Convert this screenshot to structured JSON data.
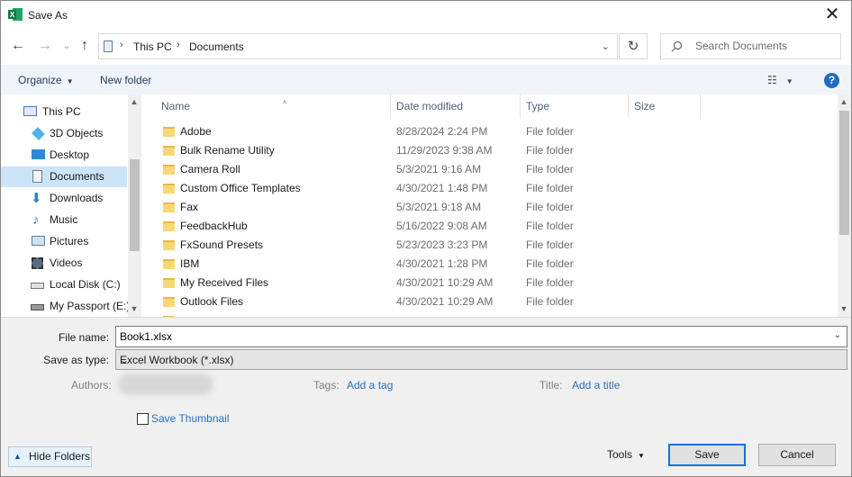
{
  "window": {
    "title": "Save As",
    "close_glyph": "✕"
  },
  "nav": {
    "back_glyph": "←",
    "forward_glyph": "→",
    "recent_glyph": "⌄",
    "up_glyph": "↑",
    "breadcrumb": [
      "This PC",
      "Documents"
    ],
    "refresh_glyph": "↻",
    "search_placeholder": "Search Documents"
  },
  "toolbar": {
    "organize": "Organize",
    "new_folder": "New folder",
    "help": "?"
  },
  "sidebar": {
    "items": [
      {
        "label": "This PC",
        "icon": "pc-icon"
      },
      {
        "label": "3D Objects",
        "icon": "cube-icon"
      },
      {
        "label": "Desktop",
        "icon": "desktop-icon"
      },
      {
        "label": "Documents",
        "icon": "documents-icon",
        "selected": true
      },
      {
        "label": "Downloads",
        "icon": "download-icon"
      },
      {
        "label": "Music",
        "icon": "music-icon"
      },
      {
        "label": "Pictures",
        "icon": "pictures-icon"
      },
      {
        "label": "Videos",
        "icon": "videos-icon"
      },
      {
        "label": "Local Disk (C:)",
        "icon": "disk-icon"
      },
      {
        "label": "My Passport (E:)",
        "icon": "drive-icon"
      }
    ]
  },
  "files": {
    "columns": [
      "Name",
      "Date modified",
      "Type",
      "Size"
    ],
    "rows": [
      {
        "name": "Adobe",
        "date": "8/28/2024 2:24 PM",
        "type": "File folder"
      },
      {
        "name": "Bulk Rename Utility",
        "date": "11/29/2023 9:38 AM",
        "type": "File folder"
      },
      {
        "name": "Camera Roll",
        "date": "5/3/2021 9:16 AM",
        "type": "File folder"
      },
      {
        "name": "Custom Office Templates",
        "date": "4/30/2021 1:48 PM",
        "type": "File folder"
      },
      {
        "name": "Fax",
        "date": "5/3/2021 9:18 AM",
        "type": "File folder"
      },
      {
        "name": "FeedbackHub",
        "date": "5/16/2022 9:08 AM",
        "type": "File folder"
      },
      {
        "name": "FxSound Presets",
        "date": "5/23/2023 3:23 PM",
        "type": "File folder"
      },
      {
        "name": "IBM",
        "date": "4/30/2021 1:28 PM",
        "type": "File folder"
      },
      {
        "name": "My Received Files",
        "date": "4/30/2021 10:29 AM",
        "type": "File folder"
      },
      {
        "name": "Outlook Files",
        "date": "4/30/2021 10:29 AM",
        "type": "File folder"
      }
    ]
  },
  "form": {
    "file_name_label": "File name:",
    "file_name_value": "Book1.xlsx",
    "save_type_label": "Save as type:",
    "save_type_value": "Excel Workbook (*.xlsx)",
    "authors_label": "Authors:",
    "tags_label": "Tags:",
    "tags_link": "Add a tag",
    "title_label": "Title:",
    "title_link": "Add a title",
    "save_thumbnail": "Save Thumbnail"
  },
  "footer": {
    "hide_folders": "Hide Folders",
    "tools": "Tools",
    "save": "Save",
    "cancel": "Cancel"
  },
  "colors": {
    "accent": "#0078d7",
    "selected": "#cce4f7",
    "link": "#2a6fbf",
    "toolbar_bg": "#f0f4f9"
  }
}
